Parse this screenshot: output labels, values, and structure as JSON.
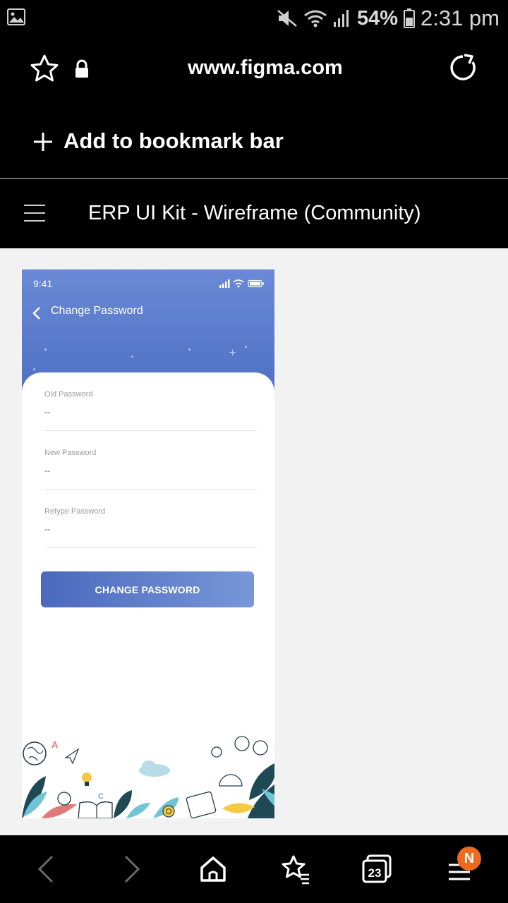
{
  "status_bar": {
    "battery": "54%",
    "time": "2:31 pm"
  },
  "browser": {
    "url": "www.figma.com",
    "bookmark_prompt": "Add to bookmark bar",
    "page_title": "ERP UI Kit - Wireframe (Community)",
    "tab_count": "23",
    "menu_badge": "N"
  },
  "mockup": {
    "time": "9:41",
    "screen_title": "Change Password",
    "fields": [
      {
        "label": "Old Password",
        "value": "--"
      },
      {
        "label": "New Password",
        "value": "--"
      },
      {
        "label": "Retype Password",
        "value": "--"
      }
    ],
    "button_label": "CHANGE PASSWORD",
    "doodle_letters": [
      "A",
      "C"
    ]
  },
  "colors": {
    "header_blue": "#5a7ccc",
    "button_blue": "#4a69bd",
    "badge_orange": "#ee6a1c"
  }
}
